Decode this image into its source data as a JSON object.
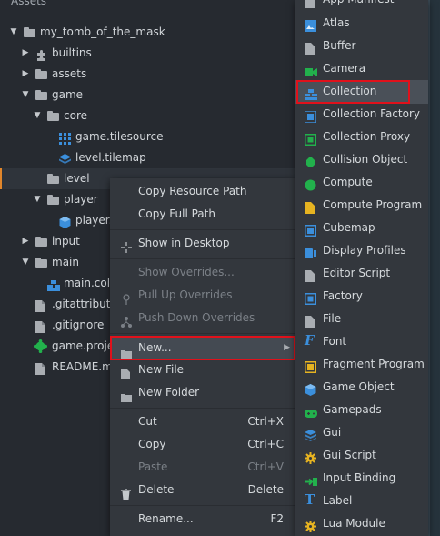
{
  "panel": {
    "title": "Assets"
  },
  "tree": [
    {
      "label": "my_tomb_of_the_mask",
      "arrow": "▼",
      "icon": "folder"
    },
    {
      "label": "builtins",
      "arrow": "▶",
      "icon": "puzzle"
    },
    {
      "label": "assets",
      "arrow": "▶",
      "icon": "folder"
    },
    {
      "label": "game",
      "arrow": "▼",
      "icon": "folder"
    },
    {
      "label": "core",
      "arrow": "▼",
      "icon": "folder"
    },
    {
      "label": "game.tilesource",
      "arrow": "",
      "icon": "tilesource"
    },
    {
      "label": "level.tilemap",
      "arrow": "",
      "icon": "tilemap"
    },
    {
      "label": "level",
      "arrow": "",
      "icon": "folder"
    },
    {
      "label": "player",
      "arrow": "▼",
      "icon": "folder"
    },
    {
      "label": "player.",
      "arrow": "",
      "icon": "cube"
    },
    {
      "label": "input",
      "arrow": "▶",
      "icon": "folder"
    },
    {
      "label": "main",
      "arrow": "▼",
      "icon": "folder"
    },
    {
      "label": "main.coll",
      "arrow": "",
      "icon": "collection"
    },
    {
      "label": ".gitattribute",
      "arrow": "",
      "icon": "file"
    },
    {
      "label": ".gitignore",
      "arrow": "",
      "icon": "file"
    },
    {
      "label": "game.projec",
      "arrow": "",
      "icon": "project"
    },
    {
      "label": "README.mc",
      "arrow": "",
      "icon": "file"
    }
  ],
  "context_menu": {
    "copy_resource_path": "Copy Resource Path",
    "copy_full_path": "Copy Full Path",
    "show_in_desktop": "Show in Desktop",
    "show_overrides": "Show Overrides...",
    "pull_up_overrides": "Pull Up Overrides",
    "push_down_overrides": "Push Down Overrides",
    "new": "New...",
    "new_file": "New File",
    "new_folder": "New Folder",
    "cut": "Cut",
    "cut_shortcut": "Ctrl+X",
    "copy": "Copy",
    "copy_shortcut": "Ctrl+C",
    "paste": "Paste",
    "paste_shortcut": "Ctrl+V",
    "delete": "Delete",
    "delete_shortcut": "Delete",
    "rename": "Rename...",
    "rename_shortcut": "F2"
  },
  "submenu": [
    {
      "label": "App Manifest",
      "icon": "file-gray-icon",
      "color": "#a9adb2"
    },
    {
      "label": "Atlas",
      "icon": "atlas-icon",
      "color": "#3b8fdc"
    },
    {
      "label": "Buffer",
      "icon": "buffer-icon",
      "color": "#a9adb2"
    },
    {
      "label": "Camera",
      "icon": "camera-icon",
      "color": "#22b14c"
    },
    {
      "label": "Collection",
      "icon": "collection-icon",
      "color": "#3b8fdc"
    },
    {
      "label": "Collection Factory",
      "icon": "collection-factory-icon",
      "color": "#3b8fdc"
    },
    {
      "label": "Collection Proxy",
      "icon": "collection-proxy-icon",
      "color": "#22b14c"
    },
    {
      "label": "Collision Object",
      "icon": "collision-object-icon",
      "color": "#22b14c"
    },
    {
      "label": "Compute",
      "icon": "compute-icon",
      "color": "#22b14c"
    },
    {
      "label": "Compute Program",
      "icon": "compute-program-icon",
      "color": "#e6b321"
    },
    {
      "label": "Cubemap",
      "icon": "cubemap-icon",
      "color": "#3b8fdc"
    },
    {
      "label": "Display Profiles",
      "icon": "display-profiles-icon",
      "color": "#3b8fdc"
    },
    {
      "label": "Editor Script",
      "icon": "editor-script-icon",
      "color": "#a9adb2"
    },
    {
      "label": "Factory",
      "icon": "factory-icon",
      "color": "#3b8fdc"
    },
    {
      "label": "File",
      "icon": "file-icon",
      "color": "#a9adb2"
    },
    {
      "label": "Font",
      "icon": "font-icon",
      "color": "#3b8fdc"
    },
    {
      "label": "Fragment Program",
      "icon": "fragment-program-icon",
      "color": "#e6b321"
    },
    {
      "label": "Game Object",
      "icon": "game-object-icon",
      "color": "#3b8fdc"
    },
    {
      "label": "Gamepads",
      "icon": "gamepads-icon",
      "color": "#22b14c"
    },
    {
      "label": "Gui",
      "icon": "gui-icon",
      "color": "#3b8fdc"
    },
    {
      "label": "Gui Script",
      "icon": "gui-script-icon",
      "color": "#e6b321"
    },
    {
      "label": "Input Binding",
      "icon": "input-binding-icon",
      "color": "#22b14c"
    },
    {
      "label": "Label",
      "icon": "label-icon",
      "color": "#3b8fdc"
    },
    {
      "label": "Lua Module",
      "icon": "lua-module-icon",
      "color": "#e6b321"
    }
  ],
  "colors": {
    "accent_orange": "#e1862b",
    "highlight_red": "#e0111b"
  }
}
